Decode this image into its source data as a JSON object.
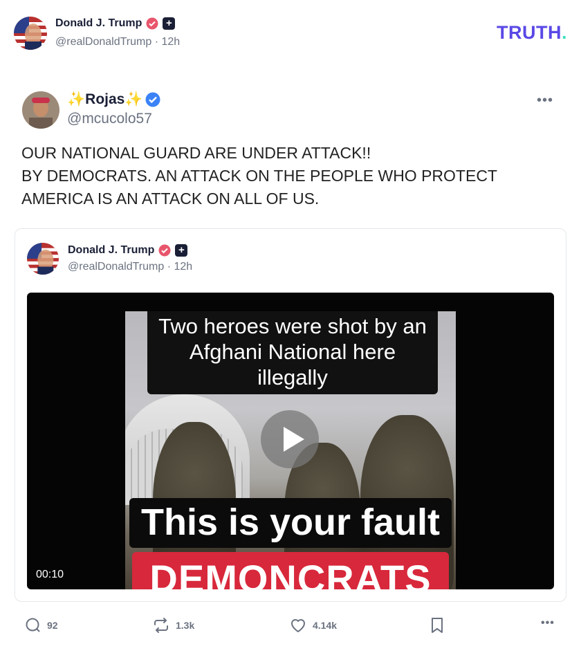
{
  "header": {
    "author_name": "Donald J. Trump",
    "author_handle": "@realDonaldTrump",
    "time": "12h",
    "logo_text": "TRUTH",
    "logo_dot": "."
  },
  "repost": {
    "author_name": "✨Rojas✨",
    "author_handle": "@mcucolo57",
    "more_label": "•••",
    "text_lines": [
      "OUR NATIONAL GUARD ARE UNDER ATTACK!!",
      "BY DEMOCRATS. AN ATTACK ON THE PEOPLE WHO PROTECT AMERICA IS AN ATTACK ON ALL OF US."
    ]
  },
  "quoted": {
    "author_name": "Donald J. Trump",
    "author_handle": "@realDonaldTrump",
    "time": "12h",
    "video": {
      "caption_top": [
        "Two heroes were shot by an",
        "Afghani National here",
        "illegally"
      ],
      "caption_big": "This is your fault",
      "caption_red": "DEMONCRATS",
      "duration": "00:10"
    }
  },
  "actions": {
    "replies": "92",
    "retruths": "1.3k",
    "likes": "4.14k",
    "more_label": "•••"
  },
  "colors": {
    "brand": "#5a48e6",
    "brand_dot": "#3ee0c0",
    "verified_pink": "#e8566c",
    "verified_blue": "#3b82f6",
    "red_banner": "#d8283b"
  },
  "icons": [
    "verified-badge-icon",
    "plus-badge-icon",
    "reply-icon",
    "retruth-icon",
    "like-icon",
    "bookmark-icon",
    "more-icon",
    "play-icon"
  ]
}
